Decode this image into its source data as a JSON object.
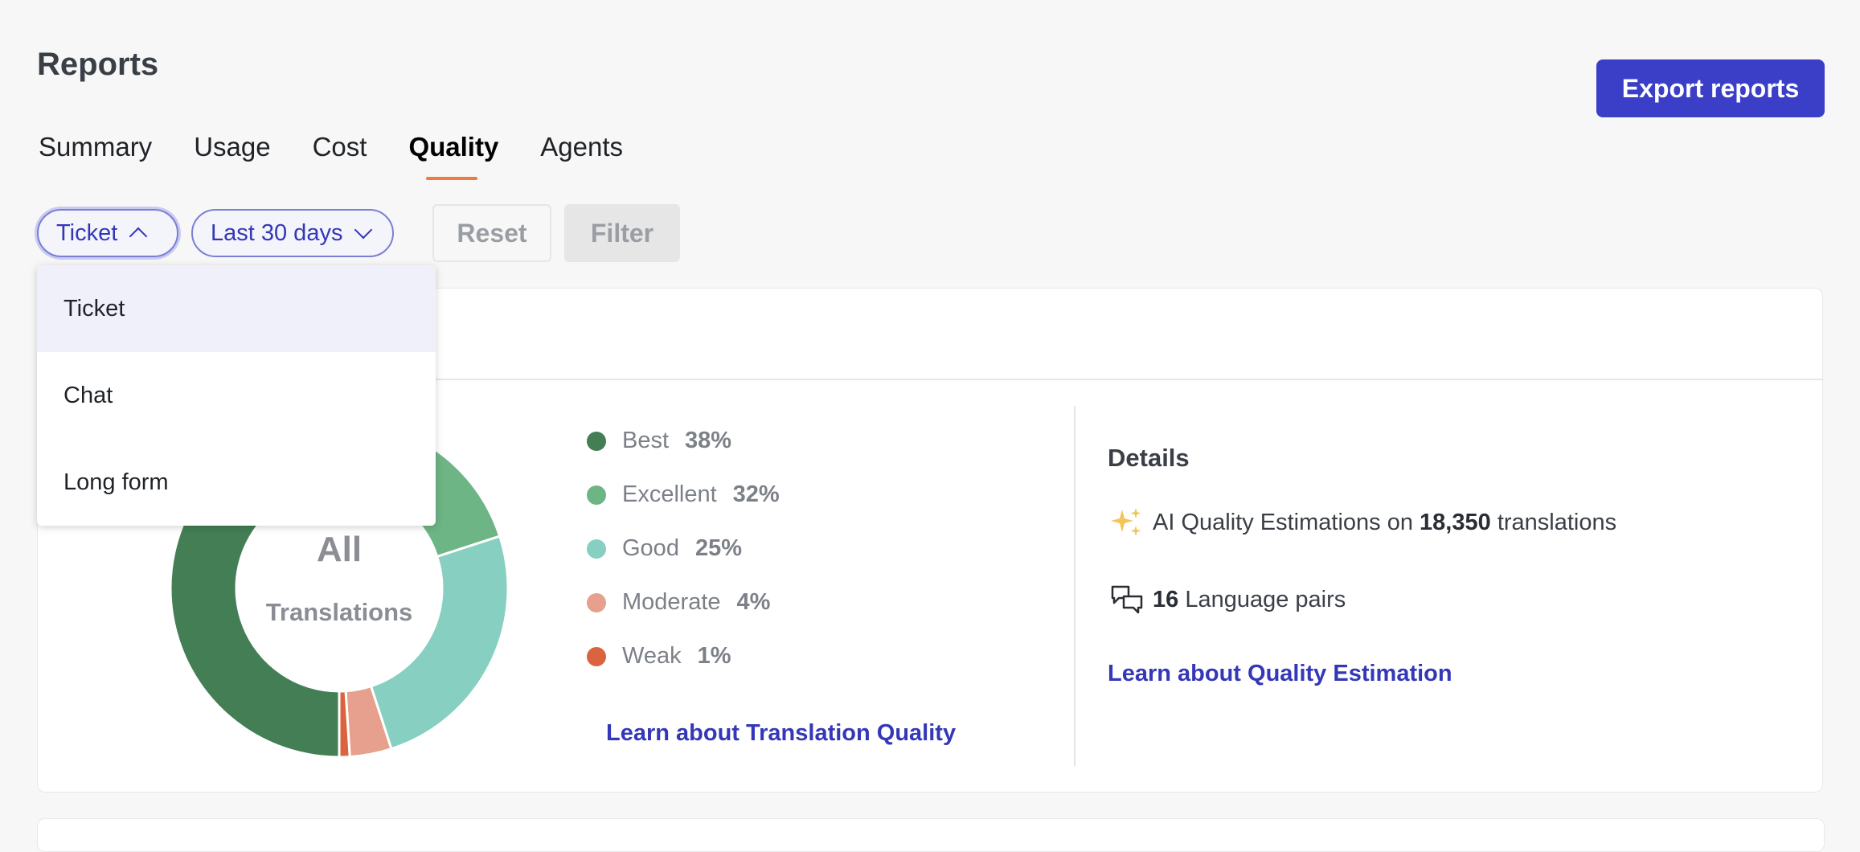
{
  "header": {
    "title": "Reports",
    "export_label": "Export reports"
  },
  "tabs": [
    {
      "label": "Summary",
      "active": false
    },
    {
      "label": "Usage",
      "active": false
    },
    {
      "label": "Cost",
      "active": false
    },
    {
      "label": "Quality",
      "active": true
    },
    {
      "label": "Agents",
      "active": false
    }
  ],
  "filters": {
    "type_selected": "Ticket",
    "date_range": "Last 30 days",
    "reset_label": "Reset",
    "filter_label": "Filter",
    "type_options": [
      "Ticket",
      "Chat",
      "Long form"
    ]
  },
  "donut": {
    "center_title": "All",
    "center_subtitle": "Translations"
  },
  "chart_data": {
    "type": "pie",
    "categories": [
      "Best",
      "Excellent",
      "Good",
      "Moderate",
      "Weak"
    ],
    "values": [
      38,
      32,
      25,
      4,
      1
    ],
    "colors": [
      "#437e55",
      "#6db585",
      "#87cfc0",
      "#e6a08d",
      "#d9643f"
    ],
    "unit": "%"
  },
  "legend": [
    {
      "label": "Best",
      "pct": "38%"
    },
    {
      "label": "Excellent",
      "pct": "32%"
    },
    {
      "label": "Good",
      "pct": "25%"
    },
    {
      "label": "Moderate",
      "pct": "4%"
    },
    {
      "label": "Weak",
      "pct": "1%"
    }
  ],
  "links": {
    "translation_quality": "Learn about Translation Quality",
    "quality_estimation": "Learn about Quality Estimation"
  },
  "details": {
    "title": "Details",
    "estimations_prefix": "AI Quality Estimations on",
    "estimations_count": "18,350",
    "estimations_suffix": "translations",
    "language_pairs_count": "16",
    "language_pairs_label": "Language pairs",
    "icons": [
      "sparkles-icon",
      "chat-bubbles-icon"
    ]
  }
}
